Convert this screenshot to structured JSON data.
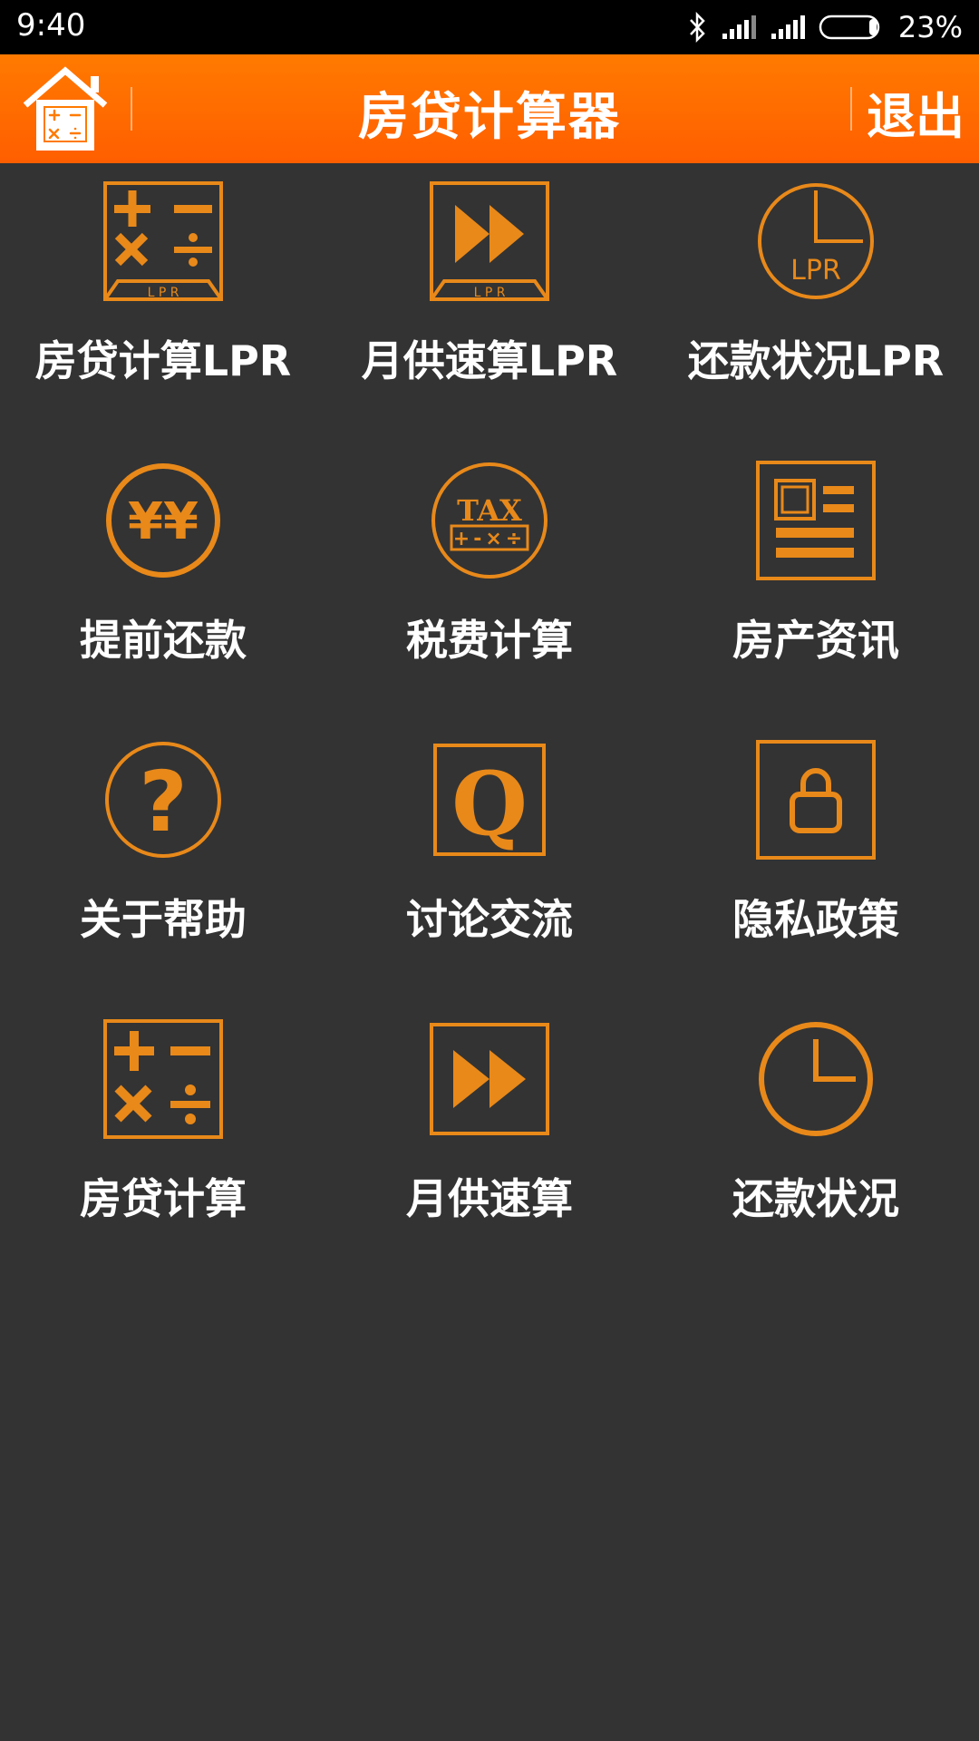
{
  "status_bar": {
    "time": "9:40",
    "battery": "23%"
  },
  "app_bar": {
    "title": "房贷计算器",
    "exit_label": "退出"
  },
  "icon_text": {
    "lpr": "L P R",
    "lpr_circle": "LPR",
    "yen": "¥¥",
    "tax": "TAX",
    "tax_ops": "+-×÷",
    "question": "?",
    "q": "Q"
  },
  "menu": [
    {
      "label": "房贷计算LPR",
      "icon": "calculator-lpr-icon"
    },
    {
      "label": "月供速算LPR",
      "icon": "fast-forward-lpr-icon"
    },
    {
      "label": "还款状况LPR",
      "icon": "clock-lpr-icon"
    },
    {
      "label": "提前还款",
      "icon": "yen-coin-icon"
    },
    {
      "label": "税费计算",
      "icon": "tax-icon"
    },
    {
      "label": "房产资讯",
      "icon": "news-icon"
    },
    {
      "label": "关于帮助",
      "icon": "question-icon"
    },
    {
      "label": "讨论交流",
      "icon": "q-discussion-icon"
    },
    {
      "label": "隐私政策",
      "icon": "lock-icon"
    },
    {
      "label": "房贷计算",
      "icon": "calculator-icon"
    },
    {
      "label": "月供速算",
      "icon": "fast-forward-icon"
    },
    {
      "label": "还款状况",
      "icon": "clock-icon"
    }
  ],
  "colors": {
    "accent": "#e8891a",
    "appbar": "#ff6a00",
    "background": "#333333"
  }
}
